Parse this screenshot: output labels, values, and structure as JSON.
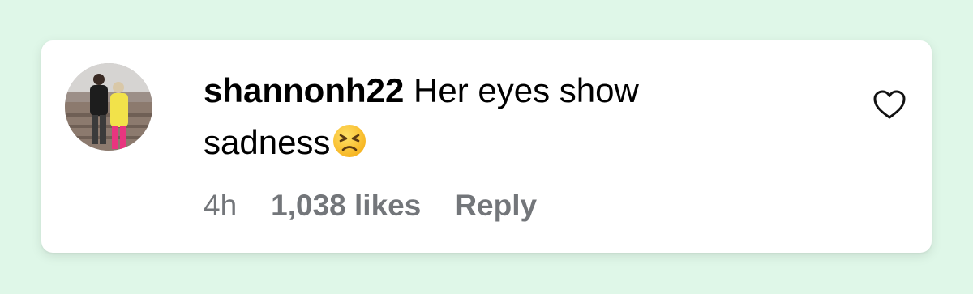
{
  "comment": {
    "username": "shannonh22",
    "text": "Her eyes show sadness",
    "emoji": "persevering-face-emoji"
  },
  "meta": {
    "time": "4h",
    "likes": "1,038 likes",
    "reply": "Reply"
  },
  "icons": {
    "like": "heart-outline-icon"
  },
  "colors": {
    "background": "#dff7e8",
    "card": "#ffffff",
    "text": "#000000",
    "muted": "#73767a"
  }
}
